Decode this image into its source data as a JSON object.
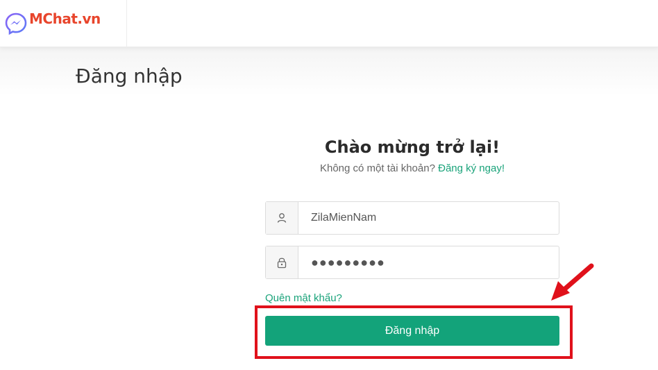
{
  "header": {
    "logo": {
      "icon": "messenger-icon",
      "text_m": "M",
      "text_rest": "Chat.vn"
    }
  },
  "page": {
    "heading": "Đăng nhập"
  },
  "form": {
    "welcome": "Chào mừng trở lại!",
    "no_account": "Không có một tài khoản?",
    "signup_link": "Đăng ký ngay!",
    "username": {
      "icon": "user-icon",
      "value": "ZilaMienNam"
    },
    "password": {
      "icon": "lock-icon",
      "value": "●●●●●●●●●"
    },
    "forgot_link": "Quên mật khẩu?",
    "submit_label": "Đăng nhập"
  },
  "annotation": {
    "color": "#e0111b",
    "arrow_icon": "red-arrow-icon"
  },
  "colors": {
    "accent": "#13a37a",
    "link": "#1aa37a",
    "logo": "#e8452c"
  }
}
